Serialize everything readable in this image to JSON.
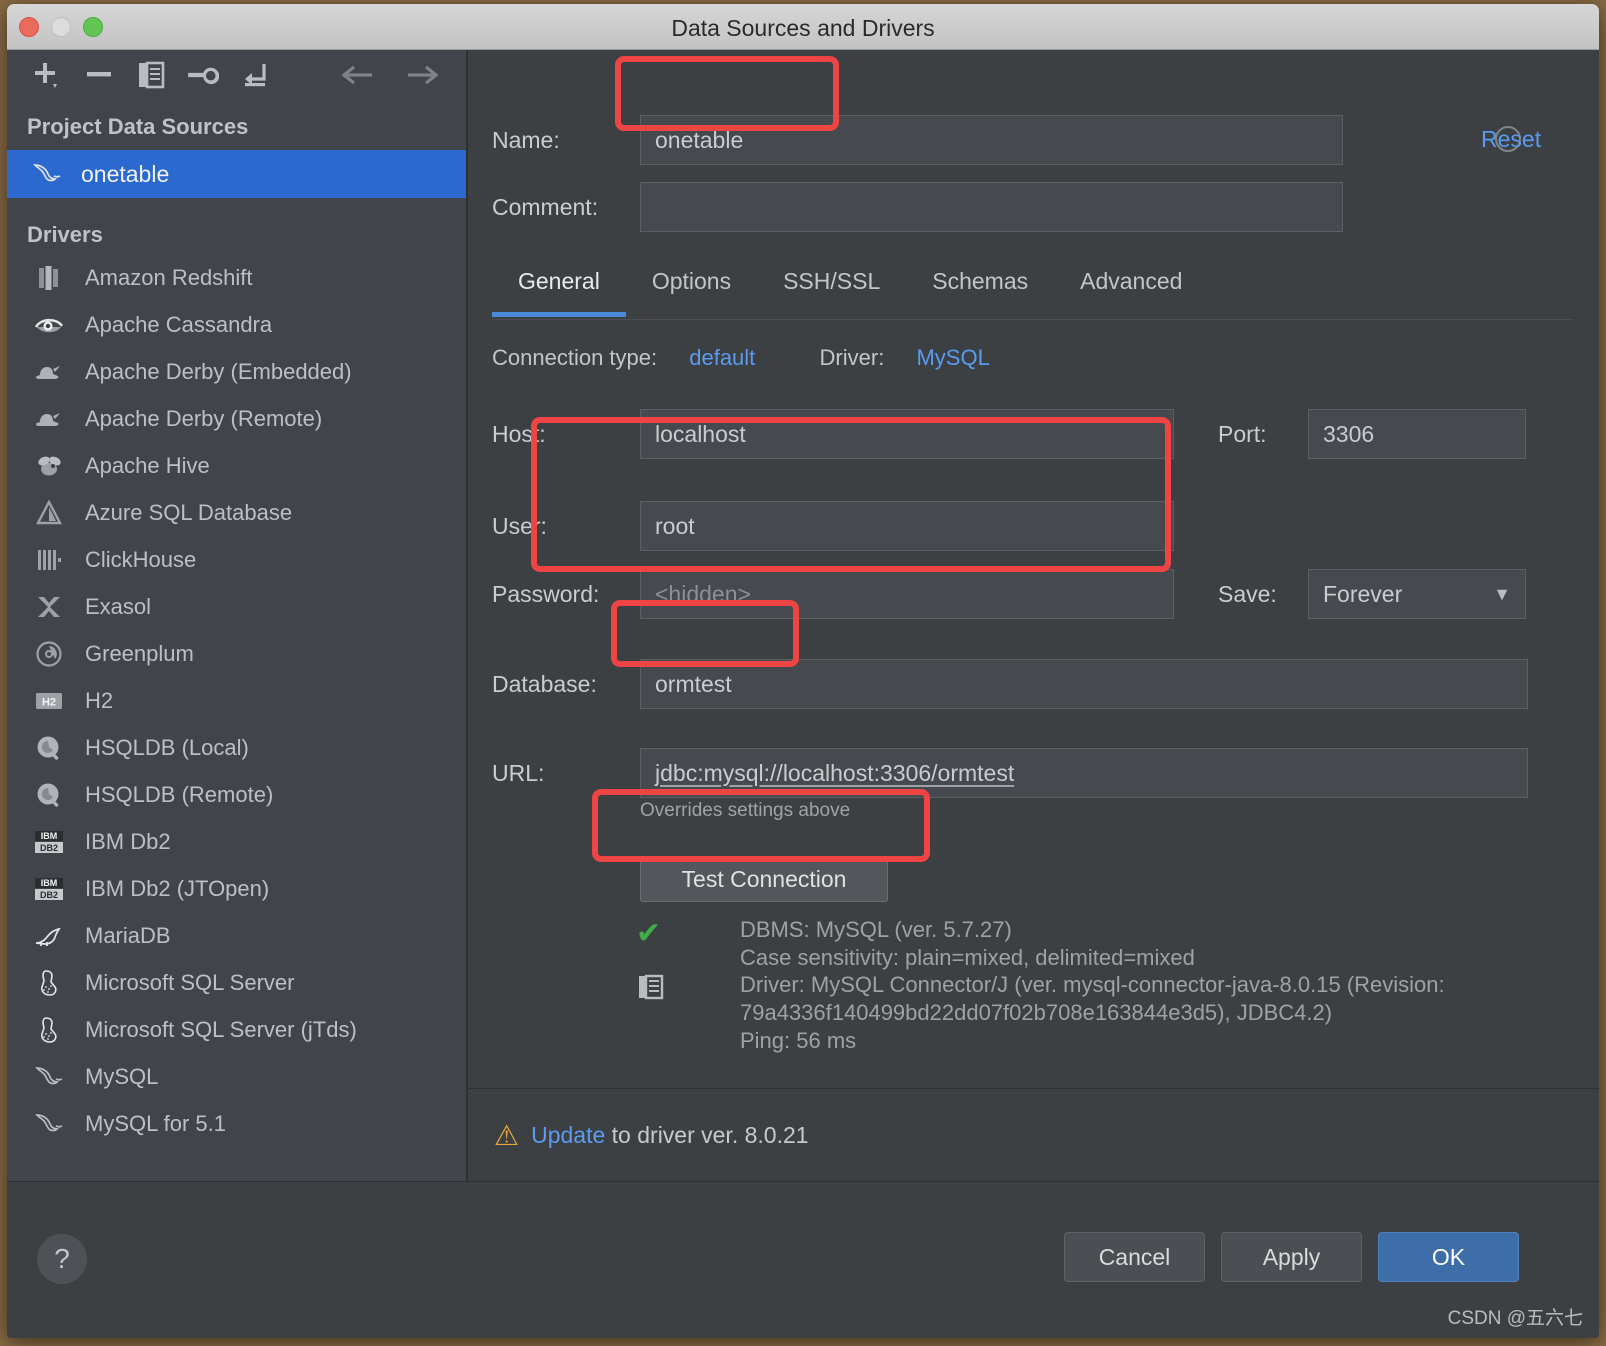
{
  "window": {
    "title": "Data Sources and Drivers"
  },
  "sidebar": {
    "toolbar": [
      {
        "name": "add-button",
        "icon": "plus-icon"
      },
      {
        "name": "remove-button",
        "icon": "minus-icon"
      },
      {
        "name": "duplicate-button",
        "icon": "copy-icon"
      },
      {
        "name": "properties-button",
        "icon": "wrench-icon"
      },
      {
        "name": "import-button",
        "icon": "import-arrow-icon"
      },
      {
        "name": "back-button",
        "icon": "arrow-left-icon"
      },
      {
        "name": "forward-button",
        "icon": "arrow-right-icon"
      }
    ],
    "project_section": "Project Data Sources",
    "data_sources": [
      {
        "label": "onetable",
        "icon": "mysql-dolphin-icon",
        "selected": true
      }
    ],
    "drivers_section": "Drivers",
    "drivers": [
      {
        "label": "Amazon Redshift",
        "icon": "redshift-icon"
      },
      {
        "label": "Apache Cassandra",
        "icon": "cassandra-eye-icon"
      },
      {
        "label": "Apache Derby (Embedded)",
        "icon": "derby-hat-icon"
      },
      {
        "label": "Apache Derby (Remote)",
        "icon": "derby-hat-icon"
      },
      {
        "label": "Apache Hive",
        "icon": "hive-bee-icon"
      },
      {
        "label": "Azure SQL Database",
        "icon": "azure-triangle-icon"
      },
      {
        "label": "ClickHouse",
        "icon": "clickhouse-bars-icon"
      },
      {
        "label": "Exasol",
        "icon": "exasol-x-icon"
      },
      {
        "label": "Greenplum",
        "icon": "greenplum-circle-icon"
      },
      {
        "label": "H2",
        "icon": "h2-badge-icon"
      },
      {
        "label": "HSQLDB (Local)",
        "icon": "hsqldb-icon"
      },
      {
        "label": "HSQLDB (Remote)",
        "icon": "hsqldb-icon"
      },
      {
        "label": "IBM Db2",
        "icon": "ibm-db2-icon"
      },
      {
        "label": "IBM Db2 (JTOpen)",
        "icon": "ibm-db2-icon"
      },
      {
        "label": "MariaDB",
        "icon": "mariadb-seal-icon"
      },
      {
        "label": "Microsoft SQL Server",
        "icon": "mssql-icon"
      },
      {
        "label": "Microsoft SQL Server (jTds)",
        "icon": "mssql-icon"
      },
      {
        "label": "MySQL",
        "icon": "mysql-dolphin-icon"
      },
      {
        "label": "MySQL for 5.1",
        "icon": "mysql-dolphin-icon"
      }
    ],
    "help_label": "?"
  },
  "panel": {
    "name_label": "Name:",
    "name_value": "onetable",
    "comment_label": "Comment:",
    "comment_value": "",
    "reset_label": "Reset",
    "tabs": [
      {
        "label": "General",
        "active": true
      },
      {
        "label": "Options",
        "active": false
      },
      {
        "label": "SSH/SSL",
        "active": false
      },
      {
        "label": "Schemas",
        "active": false
      },
      {
        "label": "Advanced",
        "active": false
      }
    ],
    "connection_type_label": "Connection type:",
    "connection_type_value": "default",
    "driver_label": "Driver:",
    "driver_value": "MySQL",
    "host_label": "Host:",
    "host_value": "localhost",
    "port_label": "Port:",
    "port_value": "3306",
    "user_label": "User:",
    "user_value": "root",
    "password_label": "Password:",
    "password_placeholder": "<hidden>",
    "save_label": "Save:",
    "save_value": "Forever",
    "database_label": "Database:",
    "database_value": "ormtest",
    "url_label": "URL:",
    "url_value": "jdbc:mysql://localhost:3306/ormtest",
    "overrides_note": "Overrides settings above",
    "test_connection_label": "Test Connection",
    "status_text": "DBMS: MySQL (ver. 5.7.27)\nCase sensitivity: plain=mixed, delimited=mixed\nDriver: MySQL Connector/J (ver. mysql-connector-java-8.0.15 (Revision:\n79a4336f140499bd22dd07f02b708e163844e3d5), JDBC4.2)\nPing: 56 ms",
    "update_link": "Update",
    "update_rest": " to driver ver. 8.0.21"
  },
  "footer": {
    "cancel_label": "Cancel",
    "apply_label": "Apply",
    "ok_label": "OK",
    "watermark": "CSDN @五六七"
  },
  "colors": {
    "accent_blue": "#5a9bf0",
    "selection_blue": "#2b69cf",
    "ok_button": "#3d6ea8",
    "highlight_red": "#ef4444",
    "success_green": "#3fae49",
    "warning_orange": "#e8a33d"
  }
}
